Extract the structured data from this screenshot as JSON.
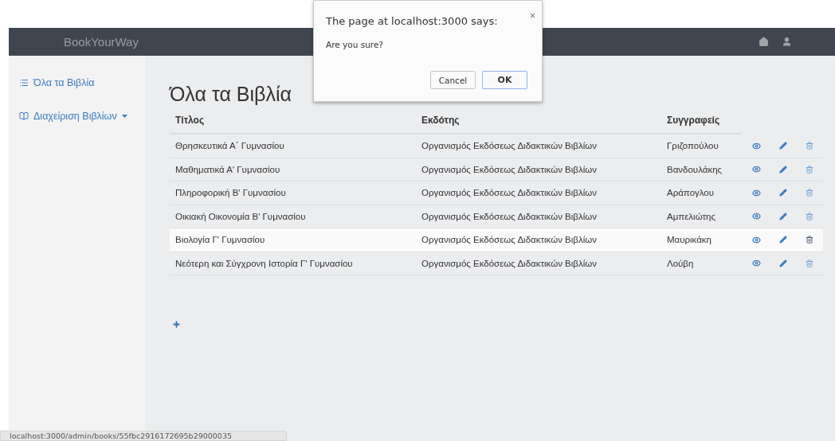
{
  "navbar": {
    "brand": "BookYourWay"
  },
  "sidebar": {
    "items": [
      {
        "label": "Όλα τα Βιβλία",
        "kind": "link"
      },
      {
        "label": "Διαχείριση Βιβλίων",
        "kind": "dropdown"
      }
    ]
  },
  "page_title": "Όλα τα Βιβλία",
  "table": {
    "columns": [
      "Τίτλος",
      "Εκδότης",
      "Συγγραφείς"
    ],
    "rows": [
      {
        "title": "Θρησκευτικά Α΄ Γυμνασίου",
        "publisher": "Οργανισμός Εκδόσεως Διδακτικών Βιβλίων",
        "authors": "Γριζοπούλου",
        "hovered": false
      },
      {
        "title": "Μαθηματικά Α' Γυμνασίου",
        "publisher": "Οργανισμός Εκδόσεως Διδακτικών Βιβλίων",
        "authors": "Βανδουλάκης",
        "hovered": false
      },
      {
        "title": "Πληροφορική Β' Γυμνασίου",
        "publisher": "Οργανισμός Εκδόσεως Διδακτικών Βιβλίων",
        "authors": "Αράπογλου",
        "hovered": false
      },
      {
        "title": "Οικιακή Οικονομία Β' Γυμνασίου",
        "publisher": "Οργανισμός Εκδόσεως Διδακτικών Βιβλίων",
        "authors": "Αμπελιώτης",
        "hovered": false
      },
      {
        "title": "Βιολογία Γ' Γυμνασίου",
        "publisher": "Οργανισμός Εκδόσεως Διδακτικών Βιβλίων",
        "authors": "Μαυρικάκη",
        "hovered": true
      },
      {
        "title": "Νεότερη και Σύγχρονη Ιστορία Γ' Γυμνασίου",
        "publisher": "Οργανισμός Εκδόσεως Διδακτικών Βιβλίων",
        "authors": "Λούβη",
        "hovered": false
      }
    ]
  },
  "dialog": {
    "title": "The page at localhost:3000 says:",
    "close": "×",
    "message": "Are you sure?",
    "buttons": [
      {
        "label": "Cancel",
        "default": false
      },
      {
        "label": "OK",
        "default": true
      }
    ]
  },
  "status_bar": {
    "url": "localhost:3000/admin/books/55fbc2916172695b29000035"
  }
}
